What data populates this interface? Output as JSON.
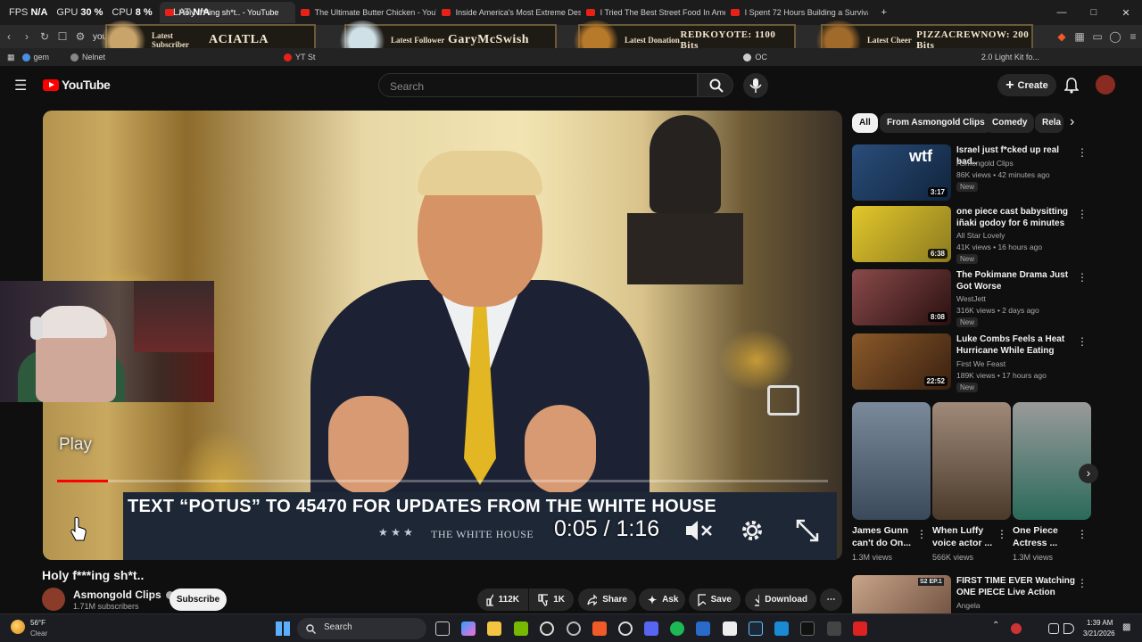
{
  "overlay_stats": {
    "fps_label": "FPS",
    "fps_value": "N/A",
    "gpu_label": "GPU",
    "gpu_value": "30 %",
    "cpu_label": "CPU",
    "cpu_value": "8 %",
    "lat_label": "LAT",
    "lat_value": "N/A"
  },
  "tabs": [
    {
      "label": "YouTube"
    },
    {
      "label": "Holy f***ing sh*t.. - YouTube",
      "active": true
    },
    {
      "label": "The Ultimate Butter Chicken - YouTu"
    },
    {
      "label": "Inside America's Most Extreme Dese"
    },
    {
      "label": "I Tried The Best Street Food In Ameri"
    },
    {
      "label": "I Spent 72 Hours Building a Survival S"
    }
  ],
  "address_bar": {
    "url_fragment": "you"
  },
  "stream_alerts": [
    {
      "label": "Latest Subscriber",
      "value": "ACIATLA"
    },
    {
      "label": "Latest Follower",
      "value": "GaryMcSwish"
    },
    {
      "label": "Latest Donation",
      "value": "REDKOYOTE: 1100 Bits"
    },
    {
      "label": "Latest Cheer",
      "value": "PIZZACREWNOW: 200 Bits"
    }
  ],
  "bookmarks": [
    {
      "label": "gem"
    },
    {
      "label": "Nelnet"
    },
    {
      "label": "YT St"
    },
    {
      "label": "OC"
    },
    {
      "label": "2.0 Light Kit fo..."
    }
  ],
  "youtube": {
    "logo": "YouTube",
    "search_placeholder": "Search",
    "create_label": "Create"
  },
  "player": {
    "banner_text": "TEXT “POTUS” TO 45470 FOR UPDATES FROM THE WHITE HOUSE",
    "banner_stars": "★ ★ ★",
    "banner_sub": "THE WHITE HOUSE",
    "time_current": "0:05",
    "time_total": "1:16",
    "timecode": "0:05 / 1:16",
    "play_label": "Play",
    "progress": 0.066
  },
  "video": {
    "title": "Holy f***ing sh*t..",
    "channel": "Asmongold Clips",
    "subscribers": "1.71M subscribers",
    "subscribe_label": "Subscribe",
    "likes": "112K",
    "dislikes": "1K",
    "share_label": "Share",
    "ask_label": "Ask",
    "save_label": "Save",
    "download_label": "Download"
  },
  "chips": [
    "All",
    "From Asmongold Clips",
    "Comedy",
    "Rela"
  ],
  "recommendations": [
    {
      "title": "Israel just f*cked up real bad..",
      "channel": "Asmongold Clips",
      "views": "86K views",
      "age": "42 minutes ago",
      "duration": "3:17",
      "badge": "New",
      "color": "#2a4d7a"
    },
    {
      "title": "one piece cast babysitting iñaki godoy for 6 minutes straight",
      "channel": "All Star Lovely",
      "views": "41K views",
      "age": "16 hours ago",
      "duration": "6:38",
      "badge": "New",
      "color": "#c9b21a"
    },
    {
      "title": "The Pokimane Drama Just Got Worse",
      "channel": "WestJett",
      "views": "316K views",
      "age": "2 days ago",
      "duration": "8:08",
      "badge": "New",
      "color": "#5a2a2a"
    },
    {
      "title": "Luke Combs Feels a Heat Hurricane While Eating Spicy ...",
      "channel": "First We Feast",
      "views": "189K views",
      "age": "17 hours ago",
      "duration": "22:52",
      "badge": "New",
      "color": "#6a3a1a"
    }
  ],
  "shorts": [
    {
      "title": "James Gunn can't do On...",
      "views": "1.3M views",
      "color": "#5a6a7a"
    },
    {
      "title": "When Luffy voice actor ...",
      "views": "566K views",
      "color": "#7a6a5a"
    },
    {
      "title": "One Piece Actress ...",
      "views": "1.3M views",
      "color": "#6a6a6a"
    }
  ],
  "last_rec": {
    "title": "FIRST TIME EVER Watching ONE PIECE Live Action Season...",
    "channel": "Angela",
    "badge": "S2 EP.1"
  },
  "taskbar": {
    "weather_temp": "56°F",
    "weather_desc": "Clear",
    "search_label": "Search",
    "time": "1:39 AM",
    "date": "3/21/2026"
  }
}
